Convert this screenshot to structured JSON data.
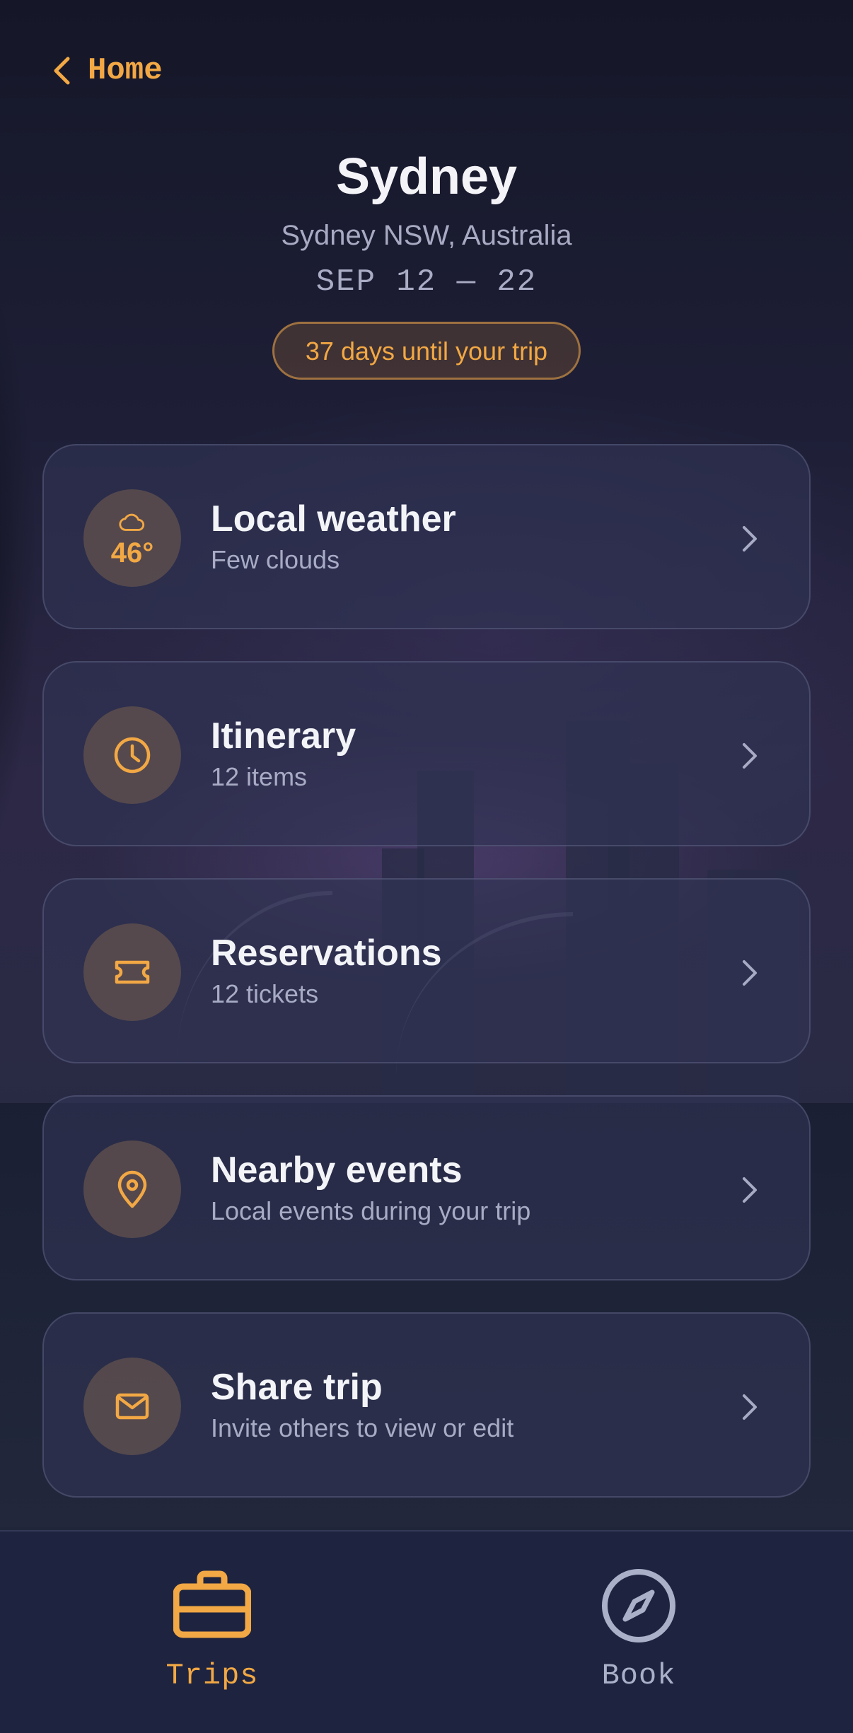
{
  "nav": {
    "back_label": "Home"
  },
  "trip": {
    "city": "Sydney",
    "location": "Sydney NSW, Australia",
    "dates": "SEP 12 — 22",
    "countdown": "37 days until your trip"
  },
  "cards": [
    {
      "icon": "cloud-icon",
      "badge": "46°",
      "title": "Local weather",
      "subtitle": "Few clouds"
    },
    {
      "icon": "clock-icon",
      "title": "Itinerary",
      "subtitle": "12 items"
    },
    {
      "icon": "ticket-icon",
      "title": "Reservations",
      "subtitle": "12 tickets"
    },
    {
      "icon": "location-pin-icon",
      "title": "Nearby events",
      "subtitle": "Local events during your trip"
    },
    {
      "icon": "envelope-icon",
      "title": "Share trip",
      "subtitle": "Invite others to view or edit"
    }
  ],
  "tabbar": {
    "tabs": [
      {
        "label": "Trips",
        "icon": "briefcase-icon",
        "active": true
      },
      {
        "label": "Book",
        "icon": "compass-icon",
        "active": false
      }
    ]
  },
  "colors": {
    "accent": "#f2a844",
    "text_muted": "#a8abc4",
    "tab_inactive": "#a9b0c8",
    "tabbar_bg": "#1e2440"
  }
}
